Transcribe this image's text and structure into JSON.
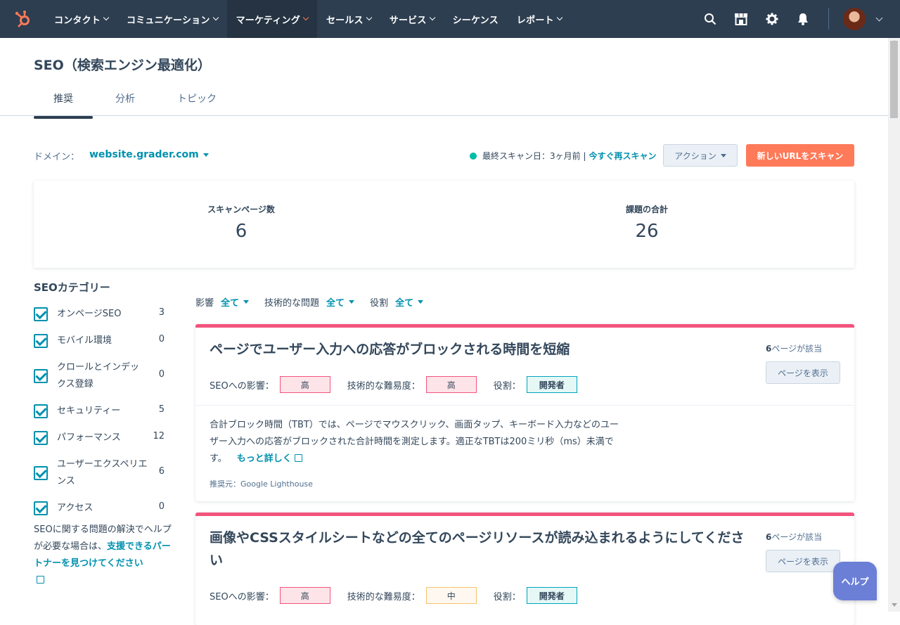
{
  "nav": {
    "items": [
      {
        "label": "コンタクト",
        "chev": true,
        "active": false
      },
      {
        "label": "コミュニケーション",
        "chev": true,
        "active": false
      },
      {
        "label": "マーケティング",
        "chev": true,
        "active": true
      },
      {
        "label": "セールス",
        "chev": true,
        "active": false
      },
      {
        "label": "サービス",
        "chev": true,
        "active": false
      },
      {
        "label": "シーケンス",
        "chev": false,
        "active": false
      },
      {
        "label": "レポート",
        "chev": true,
        "active": false
      }
    ]
  },
  "page": {
    "title": "SEO（検索エンジン最適化）"
  },
  "tabs": [
    "推奨",
    "分析",
    "トピック"
  ],
  "toolbar": {
    "domain_label": "ドメイン：",
    "domain_value": "website.grader.com",
    "scan_text": "最終スキャン日：3ヶ月前 |",
    "rescan_link": "今すぐ再スキャン",
    "action_btn": "アクション",
    "new_scan_btn": "新しいURLをスキャン"
  },
  "stats": {
    "pages_label": "スキャンページ数",
    "pages_value": "6",
    "issues_label": "課題の合計",
    "issues_value": "26"
  },
  "sidebar": {
    "title": "SEOカテゴリー",
    "items": [
      {
        "label": "オンページSEO",
        "count": "3"
      },
      {
        "label": "モバイル環境",
        "count": "0"
      },
      {
        "label": "クロールとインデックス登録",
        "count": "0"
      },
      {
        "label": "セキュリティー",
        "count": "5"
      },
      {
        "label": "パフォーマンス",
        "count": "12"
      },
      {
        "label": "ユーザーエクスペリエンス",
        "count": "6"
      },
      {
        "label": "アクセス",
        "count": "0"
      }
    ],
    "help_text": "SEOに関する問題の解決でヘルプが必要な場合は、",
    "help_link": "支援できるパートナーを見つけてください"
  },
  "filters": [
    {
      "label": "影響",
      "value": "全て"
    },
    {
      "label": "技術的な問題",
      "value": "全て"
    },
    {
      "label": "役割",
      "value": "全て"
    }
  ],
  "cards": [
    {
      "title": "ページでユーザー入力への応答がブロックされる時間を短縮",
      "pages_count": "6",
      "pages_suffix": "ページが該当",
      "view_btn": "ページを表示",
      "impact_label": "SEOへの影響：",
      "impact": "高",
      "difficulty_label": "技術的な難易度：",
      "difficulty": "高",
      "role_label": "役割：",
      "role": "開発者",
      "description": "合計ブロック時間（TBT）では、ページでマウスクリック、画面タップ、キーボード入力などのユーザー入力への応答がブロックされた合計時間を測定します。適正なTBTは200ミリ秒（ms）未満です。",
      "more_link": "もっと詳しく",
      "source": "推奨元：Google Lighthouse"
    },
    {
      "title": "画像やCSSスタイルシートなどの全てのページリソースが読み込まれるようにしてください",
      "pages_count": "6",
      "pages_suffix": "ページが該当",
      "view_btn": "ページを表示",
      "impact_label": "SEOへの影響：",
      "impact": "高",
      "difficulty_label": "技術的な難易度：",
      "difficulty": "中",
      "role_label": "役割：",
      "role": "開発者"
    }
  ],
  "help_button": "ヘルプ",
  "colors": {
    "nav_bg": "#2d3e50",
    "accent": "#0091ae",
    "orange": "#ff7a59",
    "card_bar": "#f2547d"
  }
}
